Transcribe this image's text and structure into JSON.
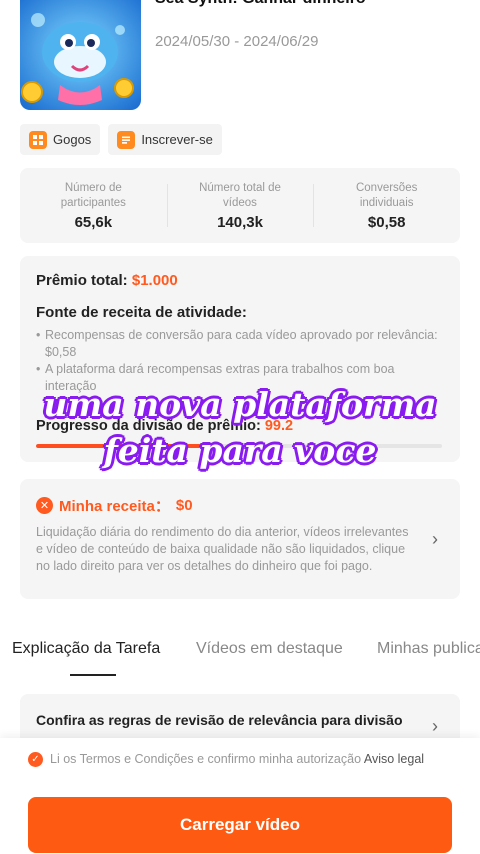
{
  "app": {
    "title": "Sea Synth: Ganhar dinheiro",
    "dates": "2024/05/30 - 2024/06/29"
  },
  "tags": [
    {
      "label": "Gogos",
      "icon": "apps-grid-icon"
    },
    {
      "label": "Inscrever-se",
      "icon": "document-icon"
    }
  ],
  "stats": [
    {
      "label": "Número de participantes",
      "value": "65,6k"
    },
    {
      "label": "Número total de vídeos",
      "value": "140,3k"
    },
    {
      "label": "Conversões individuais",
      "value": "$0,58"
    }
  ],
  "prize": {
    "total_label": "Prêmio total:",
    "total_value": "$1.000",
    "source_title": "Fonte de receita de atividade:",
    "bullets": [
      "Recompensas de conversão para cada vídeo aprovado por relevância: $0,58",
      "A plataforma dará recompensas extras para trabalhos com boa interação"
    ],
    "progress_label": "Progresso da divisão de prêmio:",
    "progress_value": "99.2",
    "progress_fraction": 0.45
  },
  "overlay": {
    "line1": "uma nova plataforma",
    "line2": "feita para voce"
  },
  "income": {
    "title": "Minha receita：",
    "amount": "$0",
    "description": "Liquidação diária do rendimento do dia anterior, vídeos irrelevantes e vídeo de conteúdo de baixa qualidade não são liquidados, clique no lado direito para ver os detalhes do dinheiro que foi pago."
  },
  "tabs": [
    {
      "label": "Explicação da Tarefa"
    },
    {
      "label": "Vídeos em destaque"
    },
    {
      "label": "Minhas publica"
    }
  ],
  "rules": {
    "text": "Confira as regras de revisão de relevância para divisão do prêmio antes de enviar o vídeo"
  },
  "footer": {
    "terms_text": "Li os Termos e Condições e confirmo minha autorização",
    "terms_link": "Aviso legal",
    "upload_label": "Carregar vídeo"
  },
  "colors": {
    "accent": "#ff5a12",
    "overlay_outline": "#8a1cf0"
  }
}
